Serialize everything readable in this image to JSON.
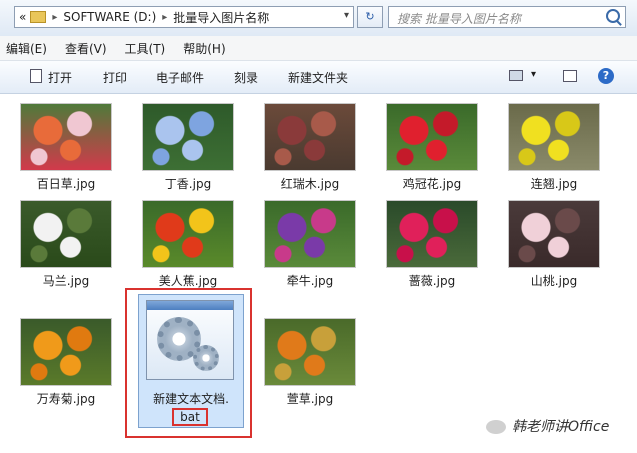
{
  "address": {
    "back_glyph": "«",
    "segments": [
      "SOFTWARE (D:)",
      "批量导入图片名称"
    ],
    "separator": "▸",
    "dropdown": "▾",
    "refresh_glyph": "↻"
  },
  "search": {
    "placeholder": "搜索 批量导入图片名称"
  },
  "menu": [
    "编辑(E)",
    "查看(V)",
    "工具(T)",
    "帮助(H)"
  ],
  "toolbar": {
    "open": "打开",
    "print": "打印",
    "email": "电子邮件",
    "burn": "刻录",
    "new_folder": "新建文件夹",
    "view_dd": "▾",
    "help": "?"
  },
  "files": [
    {
      "name": "百日草.jpg",
      "colors": [
        "#4f7a3a",
        "#e86b3a",
        "#f0c7d2",
        "#d23a4b"
      ]
    },
    {
      "name": "丁香.jpg",
      "colors": [
        "#2e5a2a",
        "#aac4ee",
        "#7ea4e0",
        "#3d6f34"
      ]
    },
    {
      "name": "红瑞木.jpg",
      "colors": [
        "#6b4a3a",
        "#8a3a3a",
        "#a85a4a",
        "#4a3a30"
      ]
    },
    {
      "name": "鸡冠花.jpg",
      "colors": [
        "#3a6a2a",
        "#e0202e",
        "#c41a2a",
        "#5a8a3a"
      ]
    },
    {
      "name": "连翘.jpg",
      "colors": [
        "#6a6a4a",
        "#f0e020",
        "#d8c818",
        "#8a8a6a"
      ]
    },
    {
      "name": "马兰.jpg",
      "colors": [
        "#3a5a2a",
        "#f2f2f2",
        "#5a7a3a",
        "#2a4a1a"
      ]
    },
    {
      "name": "美人蕉.jpg",
      "colors": [
        "#3a6a2a",
        "#e03a1a",
        "#f2c41a",
        "#5a8a2a"
      ]
    },
    {
      "name": "牵牛.jpg",
      "colors": [
        "#3a6a2a",
        "#7a3aa8",
        "#c83a8a",
        "#5a8a3a"
      ]
    },
    {
      "name": "蔷薇.jpg",
      "colors": [
        "#2a4a2a",
        "#e0205a",
        "#c8104a",
        "#4a6a3a"
      ]
    },
    {
      "name": "山桃.jpg",
      "colors": [
        "#4a3a3a",
        "#f0d0d8",
        "#6a4a4a",
        "#3a2a2a"
      ]
    },
    {
      "name": "万寿菊.jpg",
      "colors": [
        "#3a5a2a",
        "#f09a1a",
        "#e07a10",
        "#5a7a2a"
      ]
    },
    {
      "name": "萱草.jpg",
      "colors": [
        "#4a6a2a",
        "#e07a1a",
        "#c8a03a",
        "#6a8a3a"
      ]
    }
  ],
  "bat_file": {
    "line1": "新建文本文档.",
    "line2": "bat"
  },
  "watermark": "韩老师讲Office",
  "colors": {
    "highlight_border": "#d9322f",
    "selection": "#cfe4fb"
  }
}
